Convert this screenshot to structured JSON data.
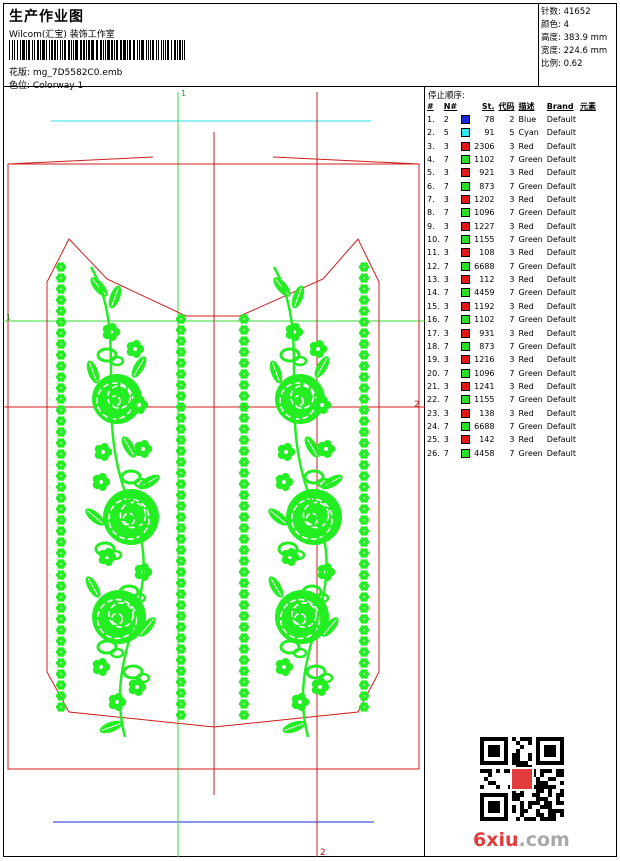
{
  "header": {
    "title": "生产作业图",
    "company": "Wilcom(汇宝) 装饰工作室",
    "design": "花版:  mg_7D5582C0.emb",
    "colorway": "色位:  Colorway 1"
  },
  "stats": {
    "stitches": "针数:  41652",
    "colors": "颜色:  4",
    "height": "高度:  383.9 mm",
    "width": "宽度:  224.6 mm",
    "scale": "比例:  0.62"
  },
  "markers": {
    "top": "1",
    "left": "1",
    "right": "2",
    "bottom": "2"
  },
  "sequence": {
    "title": "停止顺序:",
    "headers": [
      "#",
      "N#",
      "St.",
      "代码",
      "描述",
      "Brand",
      "元素"
    ],
    "rows": [
      {
        "idx": "1.",
        "n": "2",
        "color": "#1a28d8",
        "st": "78",
        "code": "2",
        "desc": "Blue",
        "brand": "Default"
      },
      {
        "idx": "2.",
        "n": "5",
        "color": "#30e8f0",
        "st": "91",
        "code": "5",
        "desc": "Cyan",
        "brand": "Default"
      },
      {
        "idx": "3.",
        "n": "3",
        "color": "#e01818",
        "st": "2306",
        "code": "3",
        "desc": "Red",
        "brand": "Default"
      },
      {
        "idx": "4.",
        "n": "7",
        "color": "#28e028",
        "st": "1102",
        "code": "7",
        "desc": "Green",
        "brand": "Default"
      },
      {
        "idx": "5.",
        "n": "3",
        "color": "#e01818",
        "st": "921",
        "code": "3",
        "desc": "Red",
        "brand": "Default"
      },
      {
        "idx": "6.",
        "n": "7",
        "color": "#28e028",
        "st": "873",
        "code": "7",
        "desc": "Green",
        "brand": "Default"
      },
      {
        "idx": "7.",
        "n": "3",
        "color": "#e01818",
        "st": "1202",
        "code": "3",
        "desc": "Red",
        "brand": "Default"
      },
      {
        "idx": "8.",
        "n": "7",
        "color": "#28e028",
        "st": "1096",
        "code": "7",
        "desc": "Green",
        "brand": "Default"
      },
      {
        "idx": "9.",
        "n": "3",
        "color": "#e01818",
        "st": "1227",
        "code": "3",
        "desc": "Red",
        "brand": "Default"
      },
      {
        "idx": "10.",
        "n": "7",
        "color": "#28e028",
        "st": "1155",
        "code": "7",
        "desc": "Green",
        "brand": "Default"
      },
      {
        "idx": "11.",
        "n": "3",
        "color": "#e01818",
        "st": "108",
        "code": "3",
        "desc": "Red",
        "brand": "Default"
      },
      {
        "idx": "12.",
        "n": "7",
        "color": "#28e028",
        "st": "6688",
        "code": "7",
        "desc": "Green",
        "brand": "Default"
      },
      {
        "idx": "13.",
        "n": "3",
        "color": "#e01818",
        "st": "112",
        "code": "3",
        "desc": "Red",
        "brand": "Default"
      },
      {
        "idx": "14.",
        "n": "7",
        "color": "#28e028",
        "st": "4459",
        "code": "7",
        "desc": "Green",
        "brand": "Default"
      },
      {
        "idx": "15.",
        "n": "3",
        "color": "#e01818",
        "st": "1192",
        "code": "3",
        "desc": "Red",
        "brand": "Default"
      },
      {
        "idx": "16.",
        "n": "7",
        "color": "#28e028",
        "st": "1102",
        "code": "7",
        "desc": "Green",
        "brand": "Default"
      },
      {
        "idx": "17.",
        "n": "3",
        "color": "#e01818",
        "st": "931",
        "code": "3",
        "desc": "Red",
        "brand": "Default"
      },
      {
        "idx": "18.",
        "n": "7",
        "color": "#28e028",
        "st": "873",
        "code": "7",
        "desc": "Green",
        "brand": "Default"
      },
      {
        "idx": "19.",
        "n": "3",
        "color": "#e01818",
        "st": "1216",
        "code": "3",
        "desc": "Red",
        "brand": "Default"
      },
      {
        "idx": "20.",
        "n": "7",
        "color": "#28e028",
        "st": "1096",
        "code": "7",
        "desc": "Green",
        "brand": "Default"
      },
      {
        "idx": "21.",
        "n": "3",
        "color": "#e01818",
        "st": "1241",
        "code": "3",
        "desc": "Red",
        "brand": "Default"
      },
      {
        "idx": "22.",
        "n": "7",
        "color": "#28e028",
        "st": "1155",
        "code": "7",
        "desc": "Green",
        "brand": "Default"
      },
      {
        "idx": "23.",
        "n": "3",
        "color": "#e01818",
        "st": "138",
        "code": "3",
        "desc": "Red",
        "brand": "Default"
      },
      {
        "idx": "24.",
        "n": "7",
        "color": "#28e028",
        "st": "6688",
        "code": "7",
        "desc": "Green",
        "brand": "Default"
      },
      {
        "idx": "25.",
        "n": "3",
        "color": "#e01818",
        "st": "142",
        "code": "3",
        "desc": "Red",
        "brand": "Default"
      },
      {
        "idx": "26.",
        "n": "7",
        "color": "#28e028",
        "st": "4458",
        "code": "7",
        "desc": "Green",
        "brand": "Default"
      }
    ]
  },
  "colors": {
    "embroidery": "#22ee22",
    "outline": "#d01c1c",
    "guide_green": "#38d838",
    "guide_red": "#d01c1c",
    "guide_cyan": "#30d8e8",
    "guide_blue": "#1a28d8"
  },
  "watermark": {
    "part_a": "6xiu",
    "part_b": ".com"
  }
}
